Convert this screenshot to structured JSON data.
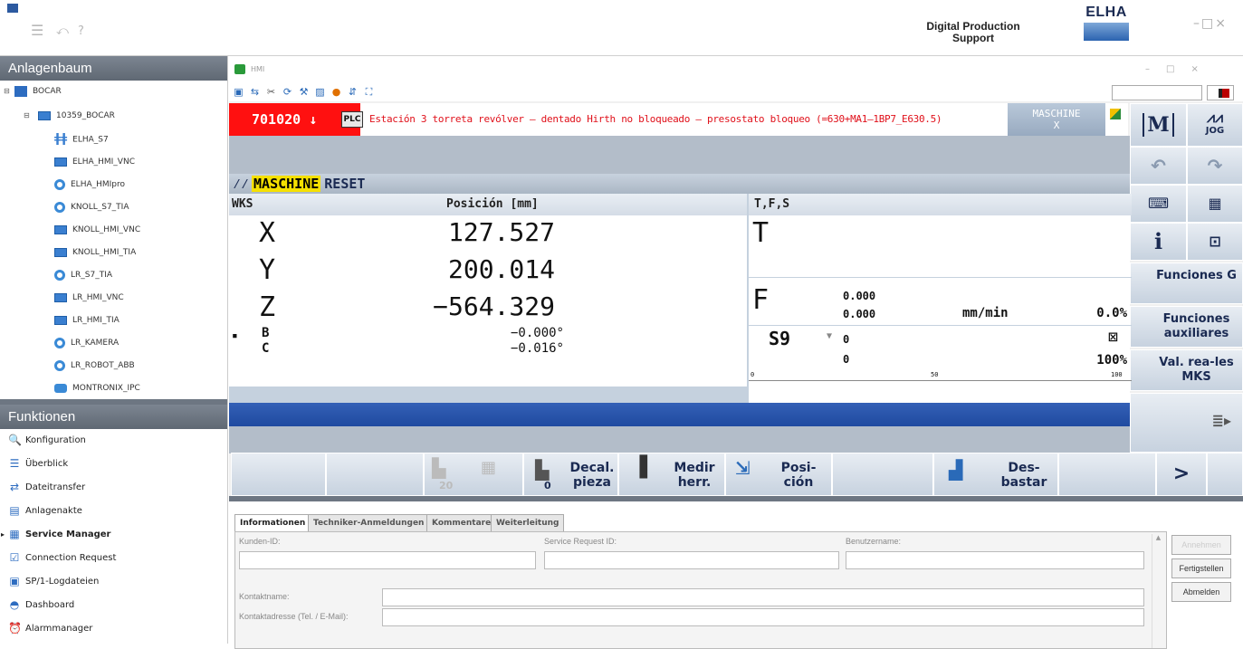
{
  "titlebar": {
    "brand_line1": "Digital Production",
    "brand_line2": "Support",
    "logo_text": "ELHA"
  },
  "sidebar": {
    "tree_header": "Anlagenbaum",
    "tree": [
      {
        "label": "BOCAR",
        "icon": "building-icon"
      },
      {
        "label": "10359_BOCAR",
        "icon": "monitor-icon"
      },
      {
        "label": "ELHA_S7",
        "icon": "s7-plc-icon"
      },
      {
        "label": "ELHA_HMI_VNC",
        "icon": "hmi-panel-icon"
      },
      {
        "label": "ELHA_HMIpro",
        "icon": "gear-icon"
      },
      {
        "label": "KNOLL_S7_TIA",
        "icon": "gear-icon"
      },
      {
        "label": "KNOLL_HMI_VNC",
        "icon": "hmi-panel-icon"
      },
      {
        "label": "KNOLL_HMI_TIA",
        "icon": "hmi-panel-icon"
      },
      {
        "label": "LR_S7_TIA",
        "icon": "gear-icon"
      },
      {
        "label": "LR_HMI_VNC",
        "icon": "hmi-panel-icon"
      },
      {
        "label": "LR_HMI_TIA",
        "icon": "hmi-panel-icon"
      },
      {
        "label": "LR_KAMERA",
        "icon": "gear-icon"
      },
      {
        "label": "LR_ROBOT_ABB",
        "icon": "gear-icon"
      },
      {
        "label": "MONTRONIX_IPC",
        "icon": "ipc-icon"
      }
    ],
    "func_header": "Funktionen",
    "functions": [
      {
        "label": "Konfiguration",
        "icon": "magnifier-icon"
      },
      {
        "label": "Überblick",
        "icon": "list-icon"
      },
      {
        "label": "Dateitransfer",
        "icon": "transfer-arrows-icon"
      },
      {
        "label": "Anlagenakte",
        "icon": "folder-icon"
      },
      {
        "label": "Service Manager",
        "icon": "service-icon"
      },
      {
        "label": "Connection Request",
        "icon": "checkbox-icon"
      },
      {
        "label": "SP/1-Logdateien",
        "icon": "log-file-icon"
      },
      {
        "label": "Dashboard",
        "icon": "gauge-icon"
      },
      {
        "label": "Alarmmanager",
        "icon": "alarm-clock-icon"
      }
    ]
  },
  "hmi": {
    "window_title": "HMI",
    "alarm_code": "701020 ↓",
    "plc_badge": "PLC",
    "alarm_text": "Estación 3 torreta revólver – dentado Hirth no bloqueado – presostato bloqueo (=630+MA1–1BP7_E630.5)",
    "machine_mode_line1": "MASCHINE",
    "machine_mode_line2": "X",
    "channel_mode": "MASCHINE",
    "channel_state": "RESET",
    "wks_header": "WKS",
    "position_header": "Posición [mm]",
    "tfs_header": "T,F,S",
    "axes": [
      {
        "name": "X",
        "value": "127.527"
      },
      {
        "name": "Y",
        "value": "200.014"
      },
      {
        "name": "Z",
        "value": "−564.329"
      },
      {
        "name": "B",
        "value": "−0.000°"
      },
      {
        "name": "C",
        "value": "−0.016°"
      }
    ],
    "tool_label": "T",
    "feed_label": "F",
    "feed_value1": "0.000",
    "feed_value2": "0.000",
    "feed_unit": "mm/min",
    "feed_override": "0.0%",
    "spindle_name": "S9",
    "spindle_value1": "0",
    "spindle_value2": "0",
    "spindle_override": "100%",
    "scale_0": "0",
    "scale_50": "50",
    "scale_100": "100",
    "right_keys": {
      "m_label": "M",
      "jog_label": "JOG",
      "info_label": "i",
      "funciones_g": "Funciones G",
      "funciones_aux": "Funciones auxiliares",
      "val_reales": "Val. rea-les MKS"
    },
    "softkeys": [
      {
        "label": ""
      },
      {
        "label": ""
      },
      {
        "label": ""
      },
      {
        "label": "Decal. pieza"
      },
      {
        "label": "Medir herr."
      },
      {
        "label": "Posi-ción"
      },
      {
        "label": ""
      },
      {
        "label": "Des-bastar"
      },
      {
        "label": ""
      },
      {
        "label": ">"
      }
    ],
    "softkey_icon_sub1": "20",
    "softkey_icon_sub2": "0"
  },
  "form": {
    "tabs": [
      "Informationen",
      "Techniker-Anmeldungen",
      "Kommentare",
      "Weiterleitung"
    ],
    "kunden_id_label": "Kunden-ID:",
    "service_request_label": "Service Request ID:",
    "benutzername_label": "Benutzername:",
    "kontaktname_label": "Kontaktname:",
    "kontaktadresse_label": "Kontaktadresse (Tel. / E-Mail):",
    "btn_annehmen": "Annehmen",
    "btn_fertigstellen": "Fertigstellen",
    "btn_abmelden": "Abmelden"
  },
  "colors": {
    "alarm_red": "#ff1010",
    "sidebar_header": "#6d7682",
    "hmi_blue": "#1f4aa0",
    "machine_yellow": "#f5e000"
  }
}
